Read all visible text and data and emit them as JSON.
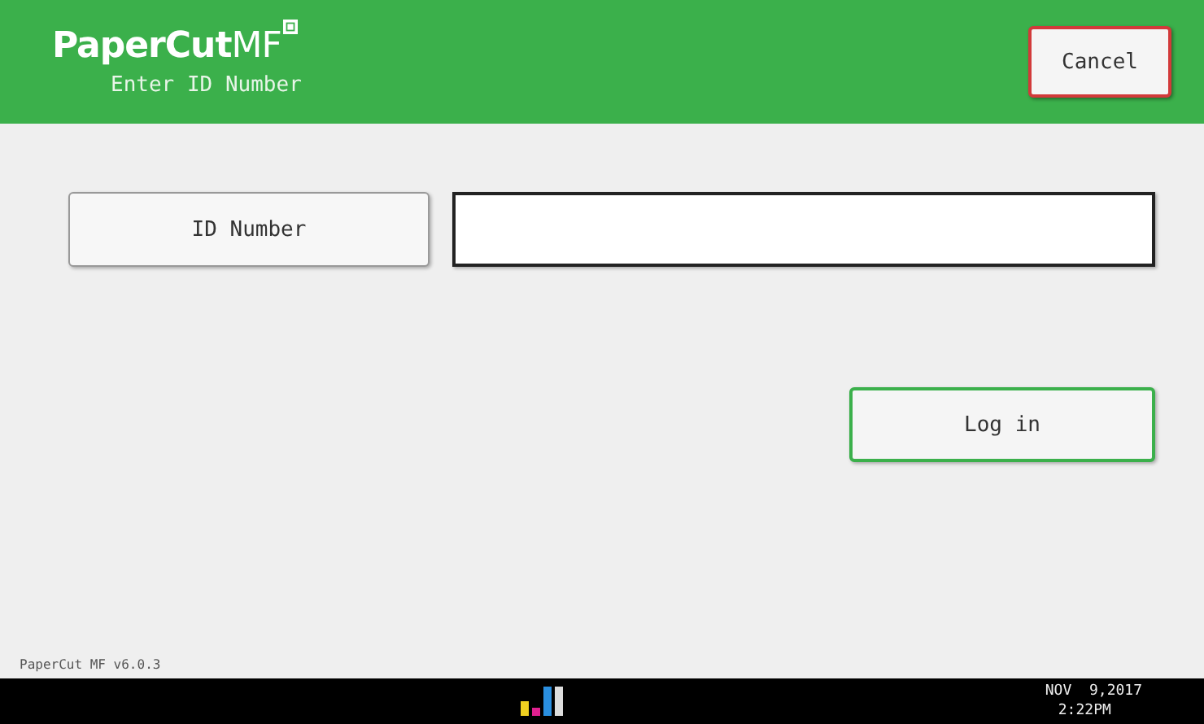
{
  "header": {
    "logo": "PaperCut",
    "logo_suffix": "MF",
    "subtitle": "Enter ID Number",
    "cancel_button": "Cancel"
  },
  "id_button": "ID Number",
  "login_button": "Log in",
  "version": "PaperCut MF v6.0.3",
  "status_bar": {
    "date": "NOV  9,2017",
    "time": "2:22PM"
  }
}
